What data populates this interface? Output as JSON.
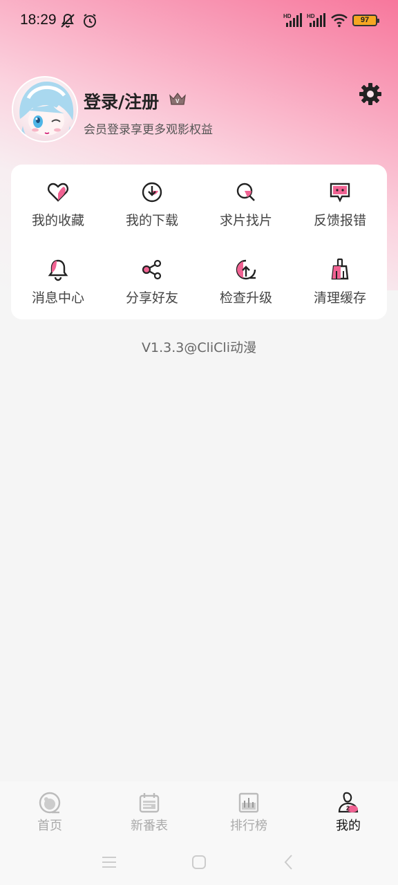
{
  "status_bar": {
    "time": "18:29",
    "battery": "97",
    "icons": [
      "mute-bell-icon",
      "alarm-icon",
      "signal-hd-icon",
      "signal-hd-icon",
      "wifi-icon",
      "battery-icon"
    ]
  },
  "profile": {
    "title": "登录/注册",
    "subtitle": "会员登录享更多观影权益"
  },
  "menu": {
    "items": [
      {
        "label": "我的收藏",
        "icon": "heart-icon"
      },
      {
        "label": "我的下载",
        "icon": "download-icon"
      },
      {
        "label": "求片找片",
        "icon": "search-icon"
      },
      {
        "label": "反馈报错",
        "icon": "feedback-icon"
      },
      {
        "label": "消息中心",
        "icon": "bell-icon"
      },
      {
        "label": "分享好友",
        "icon": "share-icon"
      },
      {
        "label": "检查升级",
        "icon": "upgrade-icon"
      },
      {
        "label": "清理缓存",
        "icon": "broom-icon"
      }
    ]
  },
  "version": "V1.3.3@CliCli动漫",
  "bottom_nav": {
    "items": [
      {
        "label": "首页",
        "icon": "home-icon",
        "active": false
      },
      {
        "label": "新番表",
        "icon": "calendar-icon",
        "active": false
      },
      {
        "label": "排行榜",
        "icon": "ranking-icon",
        "active": false
      },
      {
        "label": "我的",
        "icon": "profile-icon",
        "active": true
      }
    ]
  },
  "colors": {
    "accent": "#f06292",
    "header_gradient_top": "#f7779c",
    "background": "#f5f5f5"
  }
}
